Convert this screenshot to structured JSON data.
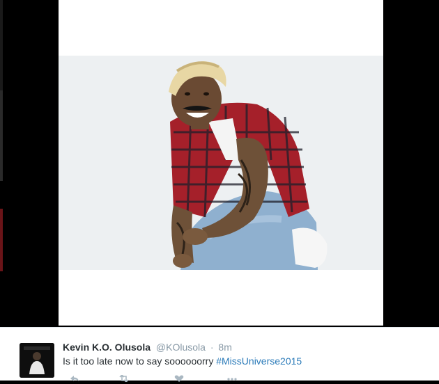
{
  "tweet": {
    "fullname": "Kevin K.O. Olusola",
    "username": "@KOlusola",
    "separator": "·",
    "timestamp": "8m",
    "text_prefix": "Is it too late now to say soooooorry ",
    "hashtag": "#MissUniverse2015"
  },
  "media": {
    "icon": "photo-of-man-with-bleached-hair-plaid-shirt-tattooed-arms"
  },
  "colors": {
    "hashtag": "#2b7bb9",
    "name": "#292f33",
    "meta": "#8899a6",
    "backdrop": "#000000"
  }
}
